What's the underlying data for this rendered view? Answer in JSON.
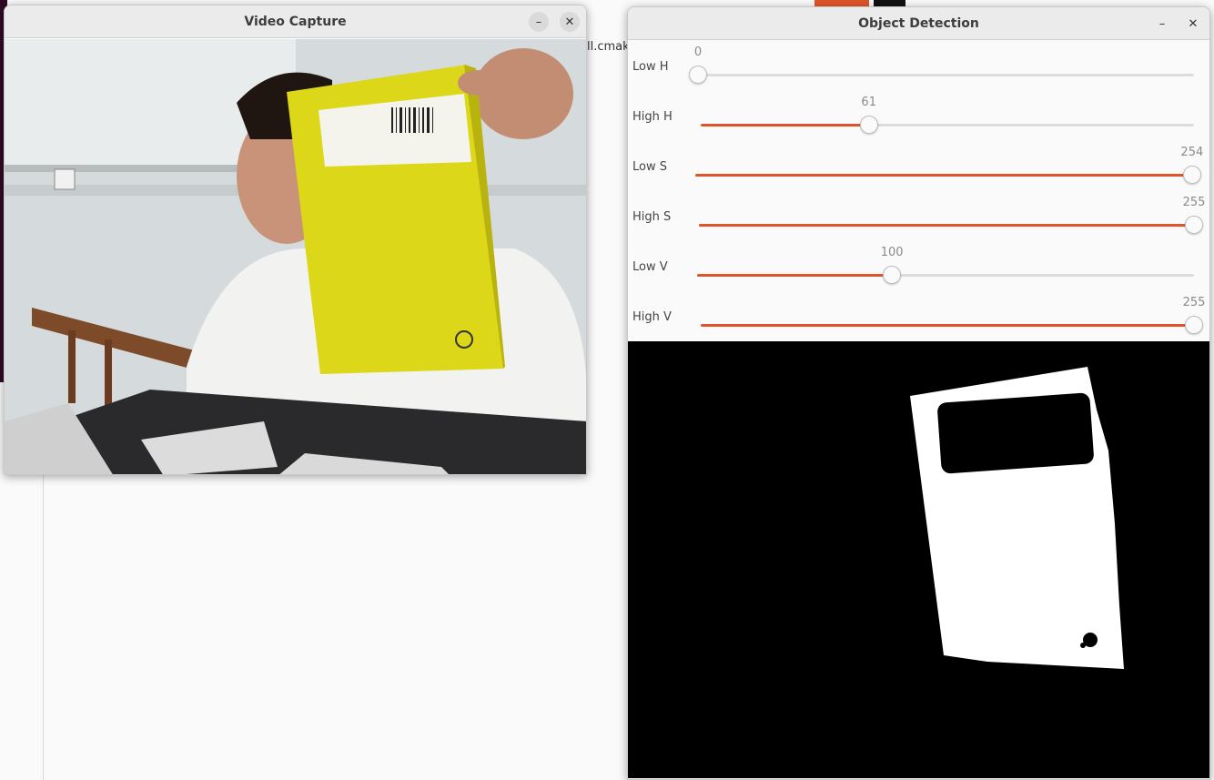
{
  "background": {
    "file_label": "ll.cmak"
  },
  "video_window": {
    "title": "Video Capture",
    "minimize_icon": "–",
    "close_icon": "✕"
  },
  "detection_window": {
    "title": "Object Detection",
    "minimize_icon": "–",
    "close_icon": "✕",
    "accent_color": "#e0542a",
    "trackbars": [
      {
        "label": "Low H",
        "value": "0",
        "max": 179
      },
      {
        "label": "High H",
        "value": "61",
        "max": 179
      },
      {
        "label": "Low S",
        "value": "254",
        "max": 255
      },
      {
        "label": "High S",
        "value": "255",
        "max": 255
      },
      {
        "label": "Low V",
        "value": "100",
        "max": 255
      },
      {
        "label": "High V",
        "value": "255",
        "max": 255
      }
    ]
  }
}
